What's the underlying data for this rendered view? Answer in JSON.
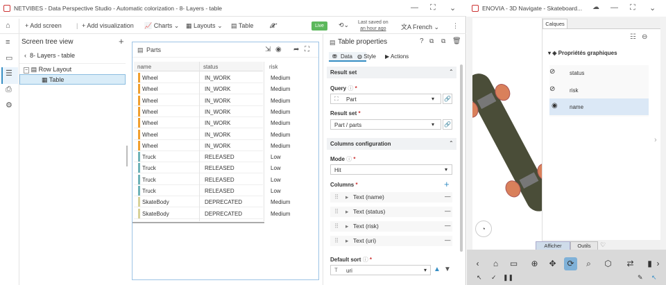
{
  "left_window": {
    "title": "NETVIBES - Data Perspective Studio - Automatic colorization - 8- Layers - table",
    "toolbar": {
      "add_screen": "Add screen",
      "add_visualization": "Add visualization",
      "charts": "Charts",
      "layouts": "Layouts",
      "table": "Table",
      "live": "Live",
      "last_saved_line1": "Last saved on",
      "last_saved_line2": "an hour ago",
      "language": "French"
    },
    "tree": {
      "title": "Screen tree view",
      "breadcrumb": "8- Layers - table",
      "items": [
        "Row Layout",
        "Table"
      ]
    },
    "parts_panel": {
      "title": "Parts",
      "columns": [
        "name",
        "status",
        "risk"
      ],
      "rows": [
        {
          "name": "Wheel",
          "status": "IN_WORK",
          "risk": "Medium",
          "color": "#f0a030"
        },
        {
          "name": "Wheel",
          "status": "IN_WORK",
          "risk": "Medium",
          "color": "#f0a030"
        },
        {
          "name": "Wheel",
          "status": "IN_WORK",
          "risk": "Medium",
          "color": "#f0a030"
        },
        {
          "name": "Wheel",
          "status": "IN_WORK",
          "risk": "Medium",
          "color": "#f0a030"
        },
        {
          "name": "Wheel",
          "status": "IN_WORK",
          "risk": "Medium",
          "color": "#f0a030"
        },
        {
          "name": "Wheel",
          "status": "IN_WORK",
          "risk": "Medium",
          "color": "#f0a030"
        },
        {
          "name": "Wheel",
          "status": "IN_WORK",
          "risk": "Medium",
          "color": "#f0a030"
        },
        {
          "name": "Truck",
          "status": "RELEASED",
          "risk": "Low",
          "color": "#6fb3b8"
        },
        {
          "name": "Truck",
          "status": "RELEASED",
          "risk": "Low",
          "color": "#6fb3b8"
        },
        {
          "name": "Truck",
          "status": "RELEASED",
          "risk": "Low",
          "color": "#6fb3b8"
        },
        {
          "name": "Truck",
          "status": "RELEASED",
          "risk": "Low",
          "color": "#6fb3b8"
        },
        {
          "name": "SkateBody",
          "status": "DEPRECATED",
          "risk": "Medium",
          "color": "#d8d29a"
        },
        {
          "name": "SkateBody",
          "status": "DEPRECATED",
          "risk": "Medium",
          "color": "#d8d29a"
        }
      ]
    },
    "properties": {
      "title": "Table properties",
      "tabs": [
        "Data",
        "Style",
        "Actions"
      ],
      "result_set_section": "Result set",
      "query_label": "Query",
      "query_value": "Part",
      "result_set_label": "Result set",
      "result_set_value": "Part / parts",
      "columns_config_section": "Columns configuration",
      "mode_label": "Mode",
      "mode_value": "Hit",
      "columns_label": "Columns",
      "columns": [
        "Text (name)",
        "Text (status)",
        "Text (risk)",
        "Text (uri)"
      ],
      "default_sort_label": "Default sort",
      "default_sort_value": "uri"
    }
  },
  "right_window": {
    "title": "ENOVIA - 3D Navigate - Skateboard...",
    "panel_tab": "Calques",
    "section_title": "Propriétés graphiques",
    "layers": [
      "status",
      "risk",
      "name"
    ],
    "bottom_tabs": [
      "Afficher",
      "Outils"
    ]
  }
}
